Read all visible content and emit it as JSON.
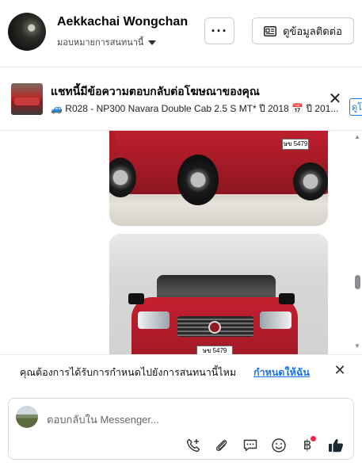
{
  "header": {
    "contact_name": "Aekkachai Wongchan",
    "assign_label": "มอบหมายการสนทนานี้",
    "more_label": "···",
    "contact_info_label": "ดูข้อมูลติดต่อ"
  },
  "ad_banner": {
    "title": "แชทนี้มีข้อความตอบกลับต่อโฆษณาของคุณ",
    "subtitle": "🚙 R028 - NP300 Navara Double Cab 2.5 S MT* ปี 2018 📅 ปี 201...",
    "edge_label": "ดูโ",
    "close_label": "✕"
  },
  "messages": {
    "photo1_plate": "ษข 5479",
    "photo2_plate": "ษข 5479"
  },
  "assign_prompt": {
    "text": "คุณต้องการได้รับการกำหนดไปยังการสนทนานี้ไหม",
    "link_label": "กำหนดให้ฉัน",
    "close_label": "✕"
  },
  "composer": {
    "placeholder": "ตอบกลับใน Messenger..."
  },
  "icons": {
    "more": "more-dots-icon",
    "contact": "id-card-icon",
    "close": "close-icon",
    "call": "phone-add-icon",
    "attach": "paperclip-icon",
    "saved_reply": "chat-bubble-icon",
    "emoji": "smiley-icon",
    "payment": "baht-icon",
    "like": "thumbs-up-icon"
  },
  "colors": {
    "accent": "#1b74e4",
    "notification_dot": "#f02849",
    "car_red": "#b51f2b"
  }
}
